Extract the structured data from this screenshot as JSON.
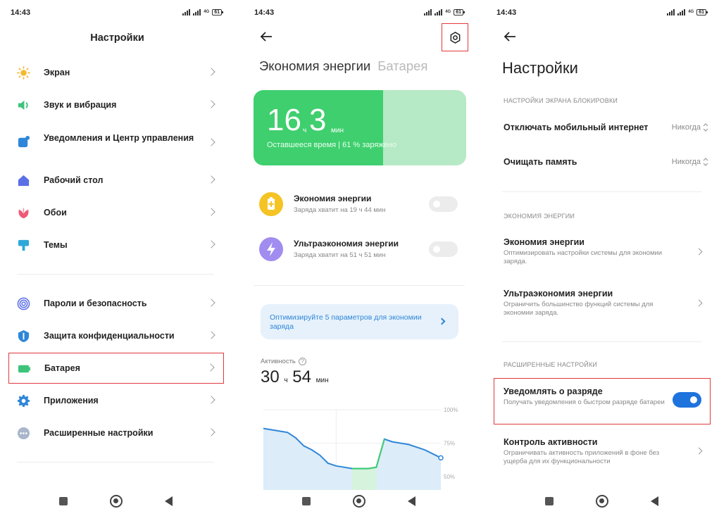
{
  "status": {
    "time": "14:43",
    "network": "4G",
    "battery": "61"
  },
  "screen1": {
    "title": "Настройки",
    "items": [
      {
        "label": "Экран",
        "icon": "sun-icon"
      },
      {
        "label": "Звук и вибрация",
        "icon": "speaker-icon"
      },
      {
        "label": "Уведомления и Центр управления",
        "icon": "notification-icon"
      },
      {
        "label": "Рабочий стол",
        "icon": "home-icon"
      },
      {
        "label": "Обои",
        "icon": "flower-icon"
      },
      {
        "label": "Темы",
        "icon": "brush-icon"
      },
      {
        "label": "Пароли и безопасность",
        "icon": "fingerprint-icon"
      },
      {
        "label": "Защита конфиденциальности",
        "icon": "privacy-shield-icon"
      },
      {
        "label": "Батарея",
        "icon": "battery-icon"
      },
      {
        "label": "Приложения",
        "icon": "gear-icon"
      },
      {
        "label": "Расширенные настройки",
        "icon": "more-dots-icon"
      }
    ],
    "colors": {
      "highlight": "#e0383b"
    }
  },
  "screen2": {
    "tab_active": "Экономия энергии",
    "tab_inactive": "Батарея",
    "battery_card": {
      "hours": "16",
      "hours_unit": "ч",
      "minutes": "3",
      "minutes_unit": "мин",
      "subtitle": "Оставшееся время | 61 % заряжено",
      "charge_fraction": 0.61
    },
    "modes": [
      {
        "title": "Экономия энергии",
        "subtitle": "Заряда хватит на 19 ч 44 мин",
        "enabled": false,
        "color": "#f5c324"
      },
      {
        "title": "Ультраэкономия энергии",
        "subtitle": "Заряда хватит на 51 ч 51 мин",
        "enabled": false,
        "color": "#a18cf0"
      }
    ],
    "optimize_banner": "Оптимизируйте 5 параметров для экономии заряда",
    "activity": {
      "label": "Активность",
      "hours": "30",
      "hours_unit": "ч",
      "minutes": "54",
      "minutes_unit": "мин"
    },
    "chart_data": {
      "type": "line",
      "y_ticks": [
        "100%",
        "75%",
        "50%"
      ],
      "ylim": [
        40,
        100
      ],
      "values": [
        86,
        85,
        84,
        83,
        79,
        73,
        70,
        66,
        60,
        58,
        57,
        56,
        56,
        56,
        57,
        78,
        76,
        75,
        74,
        72,
        70,
        67,
        64
      ],
      "charging_range": [
        11,
        14
      ],
      "colors": {
        "line": "#2f86d8",
        "area": "#dcecf8",
        "charging": "#d5f3dd",
        "charging_line": "#3fcf6e"
      }
    }
  },
  "screen3": {
    "title": "Настройки",
    "sections": {
      "lock": "НАСТРОЙКИ ЭКРАНА БЛОКИРОВКИ",
      "energy": "ЭКОНОМИЯ ЭНЕРГИИ",
      "advanced": "РАСШИРЕННЫЕ НАСТРОЙКИ"
    },
    "lock_rows": [
      {
        "label": "Отключать мобильный интернет",
        "value": "Никогда"
      },
      {
        "label": "Очищать память",
        "value": "Никогда"
      }
    ],
    "energy_rows": [
      {
        "label": "Экономия энергии",
        "desc": "Оптимизировать настройки системы для экономии заряда."
      },
      {
        "label": "Ультраэкономия энергии",
        "desc": "Ограничить большинство функций системы для экономии заряда."
      }
    ],
    "advanced_rows": [
      {
        "label": "Уведомлять о разряде",
        "desc": "Получать уведомления о быстром разряде батареи",
        "enabled": true
      },
      {
        "label": "Контроль активности",
        "desc": "Ограничивать активность приложений в фоне без ущерба для их функциональности"
      }
    ]
  }
}
